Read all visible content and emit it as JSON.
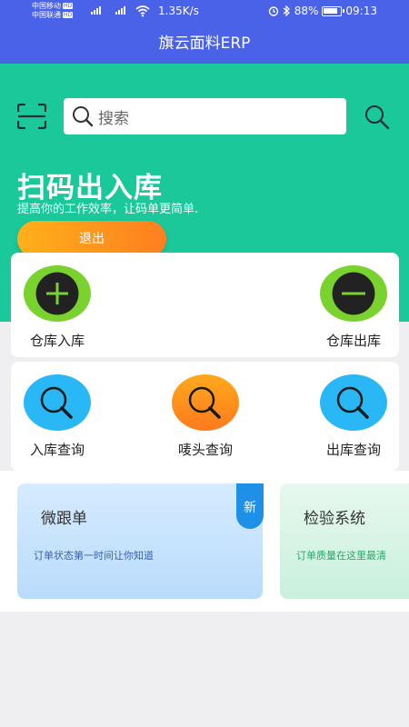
{
  "status": {
    "carrier1": "中国移动",
    "carrier2": "中国联通",
    "hd": "HD",
    "net_type1": "4G",
    "net_type2": "4G",
    "speed": "1.35K/s",
    "battery": "88%",
    "time": "09:13"
  },
  "app_title": "旗云面料ERP",
  "search": {
    "placeholder": "搜索"
  },
  "hero": {
    "title": "扫码出入库",
    "subtitle": "提高你的工作效率，让码单更简单.",
    "logout_label": "退出"
  },
  "actions_row1": [
    {
      "label": "仓库入库",
      "icon": "plus-icon"
    },
    {
      "label": "仓库出库",
      "icon": "minus-icon"
    }
  ],
  "actions_row2": [
    {
      "label": "入库查询",
      "icon": "magnifier-icon"
    },
    {
      "label": "唛头查询",
      "icon": "magnifier-icon"
    },
    {
      "label": "出库查询",
      "icon": "magnifier-icon"
    }
  ],
  "features": [
    {
      "title": "微跟单",
      "desc": "订单状态第一时间让你知道",
      "badge": "新"
    },
    {
      "title": "检验系统",
      "desc": "订单质量在这里最清"
    }
  ],
  "colors": {
    "primary": "#4a62e8",
    "hero": "#1bc89a",
    "accent_orange": "#ff8a1e",
    "accent_green": "#7ad22f",
    "accent_blue": "#29b8f5"
  }
}
